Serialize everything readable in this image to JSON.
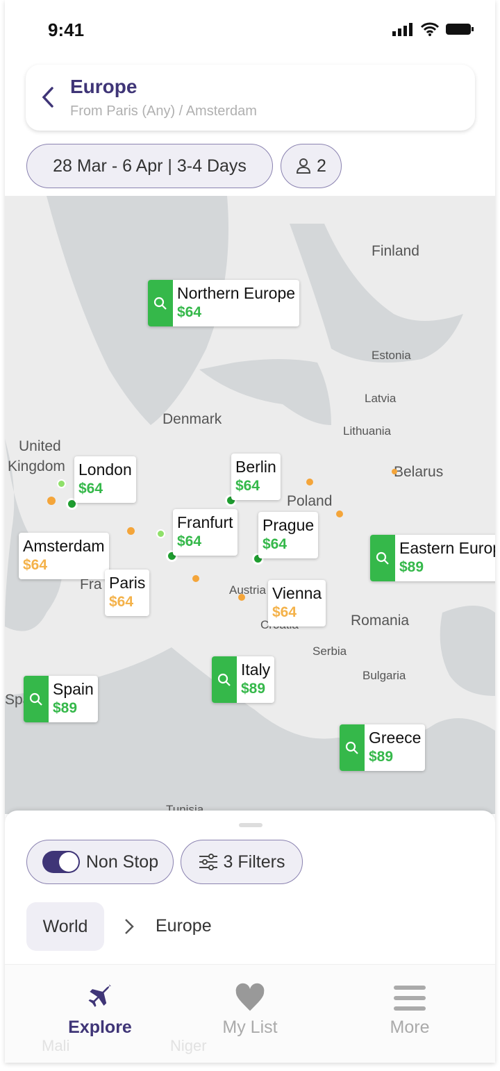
{
  "status": {
    "time": "9:41"
  },
  "header": {
    "title": "Europe",
    "subtitle": "From Paris (Any) / Amsterdam"
  },
  "chips": {
    "dates": "28 Mar - 6 Apr | 3-4 Days",
    "travelers": "2"
  },
  "map": {
    "labels": [
      "Finland",
      "Estonia",
      "Latvia",
      "Lithuania",
      "Belarus",
      "Denmark",
      "United",
      "Kingdom",
      "Poland",
      "Romania",
      "Serbia",
      "Bulgaria",
      "Croatia",
      "Austria",
      "Fra",
      "Spa",
      "Tunisia",
      "Mali",
      "Niger"
    ],
    "cards": [
      {
        "name": "Northern Europe",
        "price": "$64",
        "type": "region"
      },
      {
        "name": "London",
        "price": "$64",
        "type": "city"
      },
      {
        "name": "Berlin",
        "price": "$64",
        "type": "city"
      },
      {
        "name": "Franfurt",
        "price": "$64",
        "type": "city"
      },
      {
        "name": "Prague",
        "price": "$64",
        "type": "city"
      },
      {
        "name": "Eastern Europe",
        "price": "$89",
        "type": "region"
      },
      {
        "name": "Amsterdam",
        "price": "$64",
        "type": "city-origin"
      },
      {
        "name": "Paris",
        "price": "$64",
        "type": "city-origin"
      },
      {
        "name": "Vienna",
        "price": "$64",
        "type": "city-origin"
      },
      {
        "name": "Italy",
        "price": "$89",
        "type": "region"
      },
      {
        "name": "Spain",
        "price": "$89",
        "type": "region"
      },
      {
        "name": "Greece",
        "price": "$89",
        "type": "region"
      }
    ]
  },
  "filters": {
    "nonstop": "Non Stop",
    "nonstop_on": true,
    "filters": "3 Filters"
  },
  "breadcrumb": {
    "root": "World",
    "current": "Europe"
  },
  "nav": [
    {
      "label": "Explore",
      "icon": "plane-icon",
      "active": true
    },
    {
      "label": "My List",
      "icon": "heart-icon"
    },
    {
      "label": "More",
      "icon": "menu-icon"
    }
  ],
  "colors": {
    "accent": "#3f3577",
    "green": "#35b84a",
    "orange": "#f4b24a"
  }
}
